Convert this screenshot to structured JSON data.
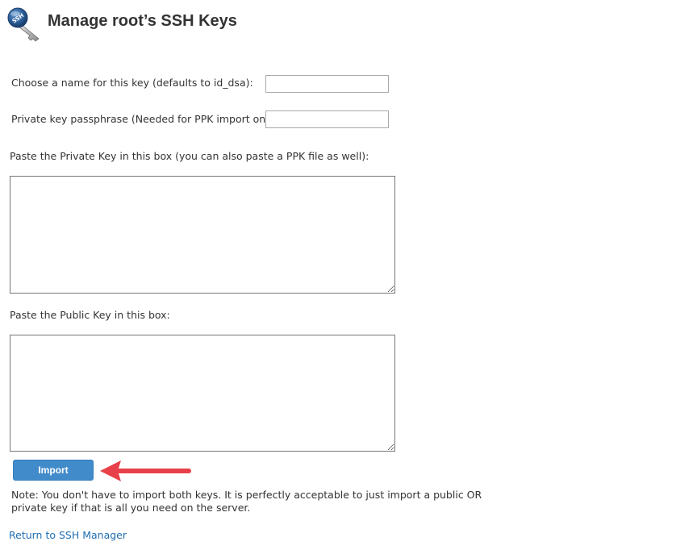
{
  "header": {
    "title": "Manage root’s SSH Keys",
    "icon": "ssh-key-icon",
    "icon_label": "SSH"
  },
  "form": {
    "key_name": {
      "label": "Choose a name for this key (defaults to id_dsa):",
      "value": ""
    },
    "passphrase": {
      "label": "Private key passphrase (Needed for PPK import only):",
      "value": ""
    },
    "private_key": {
      "label": "Paste the Private Key in this box (you can also paste a PPK file as well):",
      "value": ""
    },
    "public_key": {
      "label": "Paste the Public Key in this box:",
      "value": ""
    },
    "import_label": "Import",
    "note": "Note: You don't have to import both keys. It is perfectly acceptable to just import a public OR private key if that is all you need on the server."
  },
  "links": {
    "return_label": "Return to SSH Manager"
  },
  "colors": {
    "button": "#428bca",
    "link": "#1f6fb2",
    "annotation_arrow": "#e8404a"
  }
}
